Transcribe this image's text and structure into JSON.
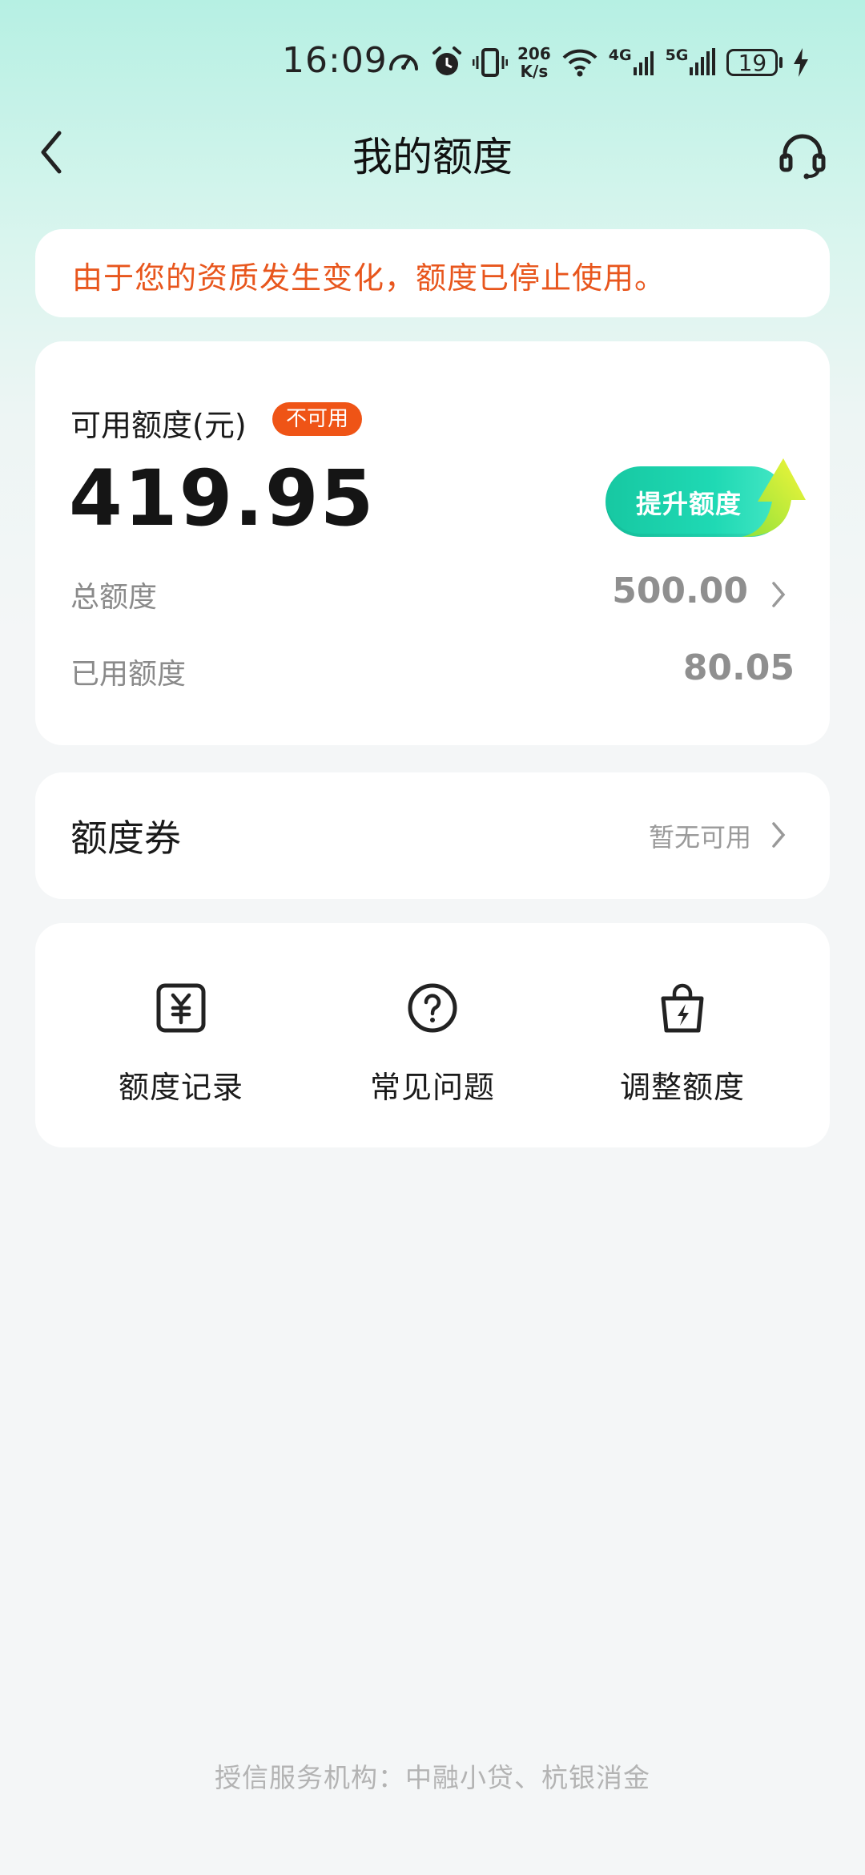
{
  "status_bar": {
    "time": "16:09",
    "net_speed_value": "206",
    "net_speed_unit": "K/s",
    "signal1_label": "4G",
    "signal2_label": "5G",
    "battery": "19",
    "icons": [
      "speedometer-icon",
      "alarm-icon",
      "vibrate-icon",
      "wifi-icon",
      "signal-4g-icon",
      "signal-5g-icon",
      "battery-icon",
      "charging-icon"
    ]
  },
  "nav": {
    "title": "我的额度",
    "back_icon": "chevron-left-icon",
    "support_icon": "headset-icon"
  },
  "notice": {
    "text": "由于您的资质发生变化，额度已停止使用。",
    "color": "#e8561d"
  },
  "quota": {
    "label": "可用额度(元)",
    "badge": "不可用",
    "badge_color": "#ef5416",
    "amount": "419.95",
    "raise_button": "提升额度",
    "total_label": "总额度",
    "total_value": "500.00",
    "used_label": "已用额度",
    "used_value": "80.05"
  },
  "coupon": {
    "title": "额度券",
    "status": "暂无可用"
  },
  "shortcuts": [
    {
      "label": "额度记录",
      "icon": "yuan-receipt-icon"
    },
    {
      "label": "常见问题",
      "icon": "question-circle-icon"
    },
    {
      "label": "调整额度",
      "icon": "bolt-bag-icon"
    }
  ],
  "footer": {
    "text": "授信服务机构：中融小贷、杭银消金"
  },
  "colors": {
    "accent_green": "#17c8a2",
    "warning_orange": "#e8561d",
    "background_top": "#b6f0e3"
  }
}
